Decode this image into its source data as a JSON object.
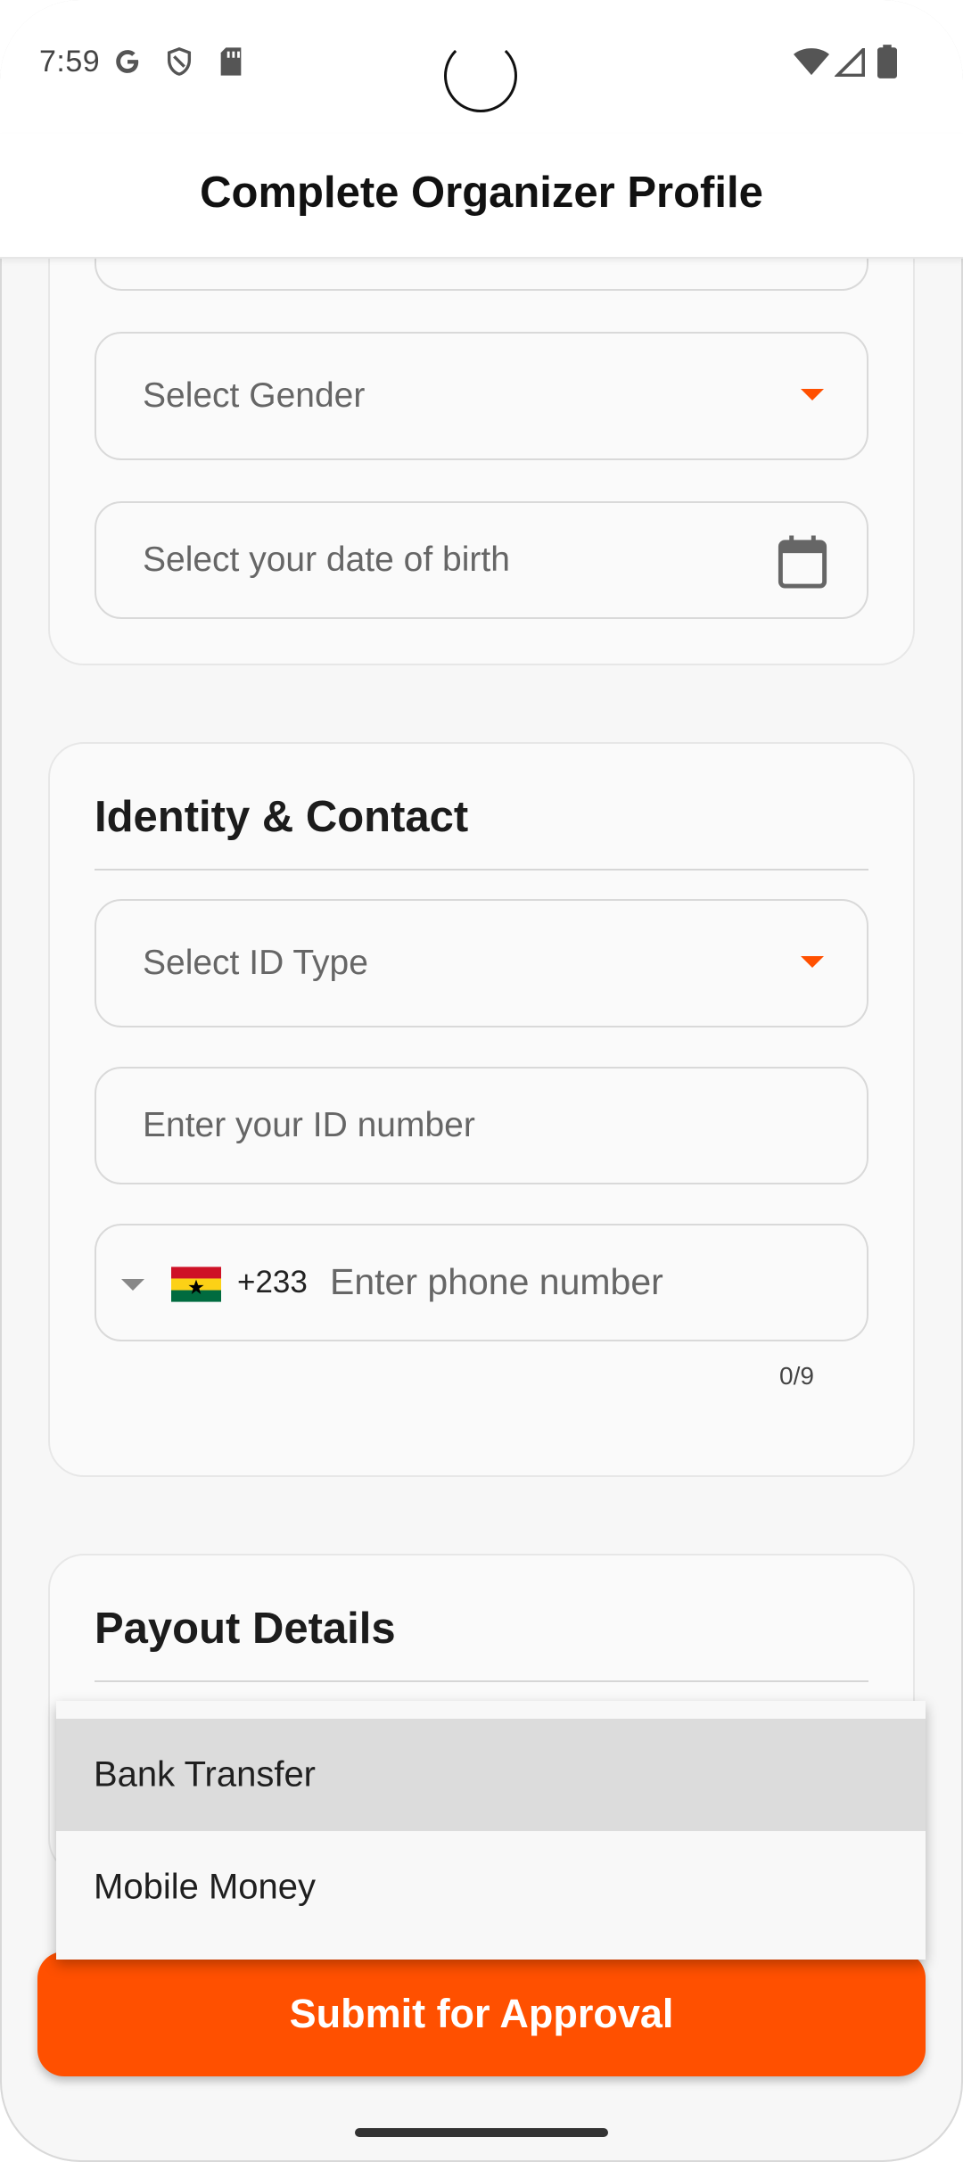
{
  "status_bar": {
    "time": "7:59",
    "left_icons": [
      "google-g-icon",
      "shield-icon",
      "sd-card-icon"
    ],
    "right_icons": [
      "wifi-icon",
      "signal-icon",
      "battery-icon"
    ]
  },
  "app_bar": {
    "title": "Complete Organizer Profile"
  },
  "personal_card": {
    "gender_placeholder": "Select Gender",
    "dob_placeholder": "Select your date of birth"
  },
  "identity_card": {
    "title": "Identity & Contact",
    "id_type_placeholder": "Select ID Type",
    "id_number_placeholder": "Enter your ID number",
    "phone": {
      "flag": "🇬🇭",
      "dial_code": "+233",
      "placeholder": "Enter phone number",
      "char_count": "0/9"
    }
  },
  "payout_card": {
    "title": "Payout Details"
  },
  "payout_menu": {
    "options": [
      "Bank Transfer",
      "Mobile Money"
    ],
    "highlighted": "Bank Transfer"
  },
  "submit": {
    "label": "Submit for Approval"
  },
  "colors": {
    "accent": "#ff5000",
    "background": "#f7f7f7",
    "card": "#fafafa"
  }
}
